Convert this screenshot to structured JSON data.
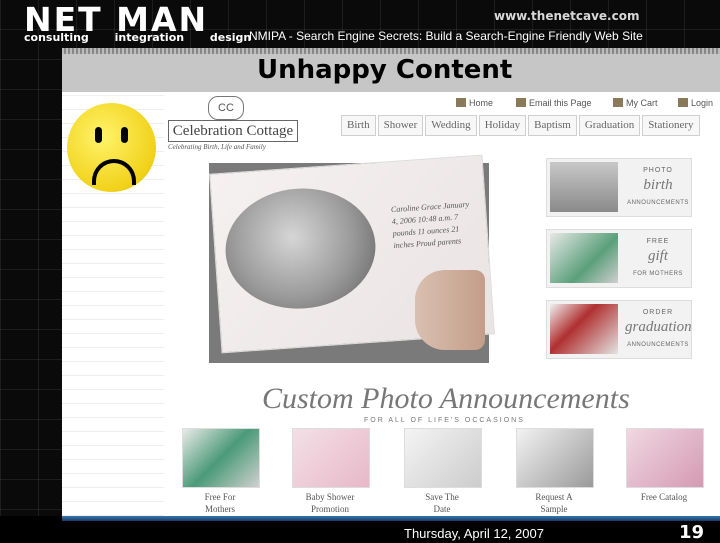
{
  "header": {
    "logo_main": "NET MAN",
    "logo_sub": "consulting integration design",
    "site_url": "www.thenetcave.com",
    "slide_header": "NMIPA - Search Engine Secrets: Build a Search-Engine Friendly Web Site"
  },
  "slide": {
    "title": "Unhappy Content",
    "footer_date": "Thursday, April 12, 2007",
    "page_number": "19"
  },
  "site": {
    "brand_name": "Celebration Cottage",
    "brand_badge": "CC",
    "tagline": "Celebrating Birth, Life and Family",
    "top_links": [
      "Home",
      "Email this Page",
      "My Cart",
      "Login"
    ],
    "tabs": [
      "Birth",
      "Shower",
      "Wedding",
      "Holiday",
      "Baptism",
      "Graduation",
      "Stationery"
    ],
    "hero_text": "Caroline Grace  January 4, 2006  10:48 a.m.  7 pounds 11 ounces  21 inches  Proud parents",
    "promos": [
      {
        "line1": "PHOTO",
        "line2": "birth",
        "line3": "ANNOUNCEMENTS"
      },
      {
        "line1": "FREE",
        "line2": "gift",
        "line3": "FOR MOTHERS"
      },
      {
        "line1": "ORDER",
        "line2": "graduation",
        "line3": "ANNOUNCEMENTS"
      }
    ],
    "section_title": "Custom Photo Announcements",
    "section_sub": "FOR ALL OF LIFE'S OCCASIONS",
    "thumbnails": [
      {
        "label1": "Free For",
        "label2": "Mothers"
      },
      {
        "label1": "Baby Shower",
        "label2": "Promotion"
      },
      {
        "label1": "Save The",
        "label2": "Date"
      },
      {
        "label1": "Request A",
        "label2": "Sample"
      },
      {
        "label1": "Free Catalog",
        "label2": ""
      }
    ]
  },
  "colors": {
    "title_bar": "#c6c6c6",
    "smiley": "#f1d21a",
    "footer_accent": "#3a78b0"
  }
}
